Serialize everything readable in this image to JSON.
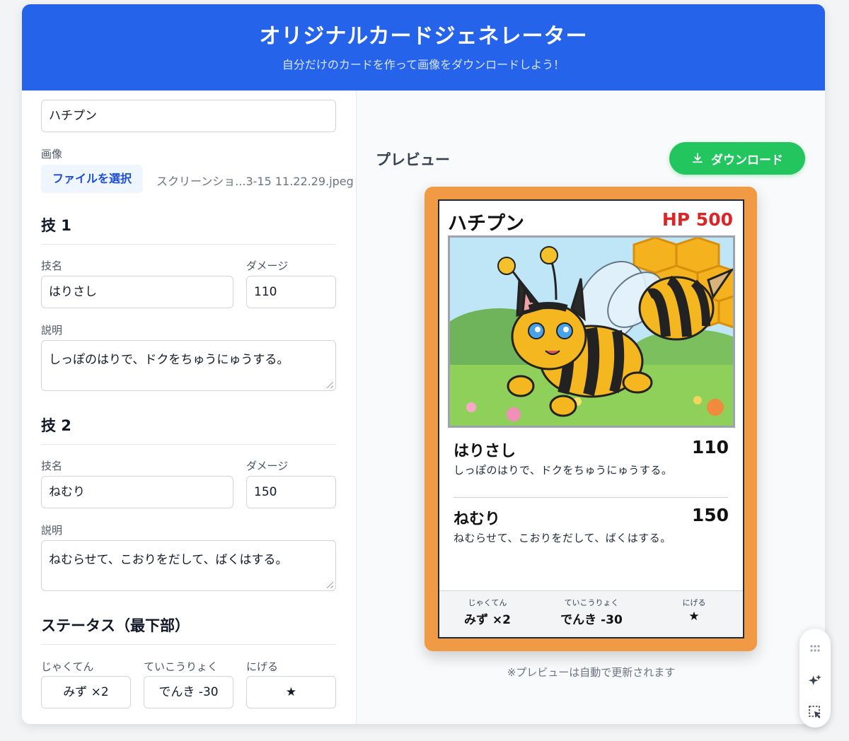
{
  "header": {
    "title": "オリジナルカードジェネレーター",
    "subtitle": "自分だけのカードを作って画像をダウンロードしよう！"
  },
  "form": {
    "card_name_value": "ハチプン",
    "image_label": "画像",
    "file_button": "ファイルを選択",
    "file_name": "スクリーンショ...3-15 11.22.29.jpeg",
    "attack1": {
      "section": "技 1",
      "name_label": "技名",
      "damage_label": "ダメージ",
      "name": "はりさし",
      "damage": "110",
      "desc_label": "説明",
      "desc": "しっぽのはりで、ドクをちゅうにゅうする。"
    },
    "attack2": {
      "section": "技 2",
      "name_label": "技名",
      "damage_label": "ダメージ",
      "name": "ねむり",
      "damage": "150",
      "desc_label": "説明",
      "desc": "ねむらせて、こおりをだして、ばくはする。"
    },
    "status": {
      "section": "ステータス（最下部）",
      "weakness_label": "じゃくてん",
      "weakness": "みず ×2",
      "resistance_label": "ていこうりょく",
      "resistance": "でんき -30",
      "retreat_label": "にげる",
      "retreat": "★"
    }
  },
  "preview": {
    "title": "プレビュー",
    "download_label": "ダウンロード",
    "note": "※プレビューは自動で更新されます",
    "card": {
      "name": "ハチプン",
      "hp": "HP 500",
      "attack1": {
        "name": "はりさし",
        "damage": "110",
        "desc": "しっぽのはりで、ドクをちゅうにゅうする。"
      },
      "attack2": {
        "name": "ねむり",
        "damage": "150",
        "desc": "ねむらせて、こおりをだして、ばくはする。"
      },
      "status": {
        "weakness_label": "じゃくてん",
        "weakness": "みず ×2",
        "resistance_label": "ていこうりょく",
        "resistance": "でんき -30",
        "retreat_label": "にげる",
        "retreat": "★"
      }
    }
  },
  "colors": {
    "header_bg": "#2563eb",
    "download_bg": "#22c55e",
    "card_frame": "#f09a45",
    "hp_red": "#dc2626"
  },
  "icons": [
    "download-icon",
    "drag-handle-icon",
    "sparkle-icon",
    "select-region-icon"
  ]
}
